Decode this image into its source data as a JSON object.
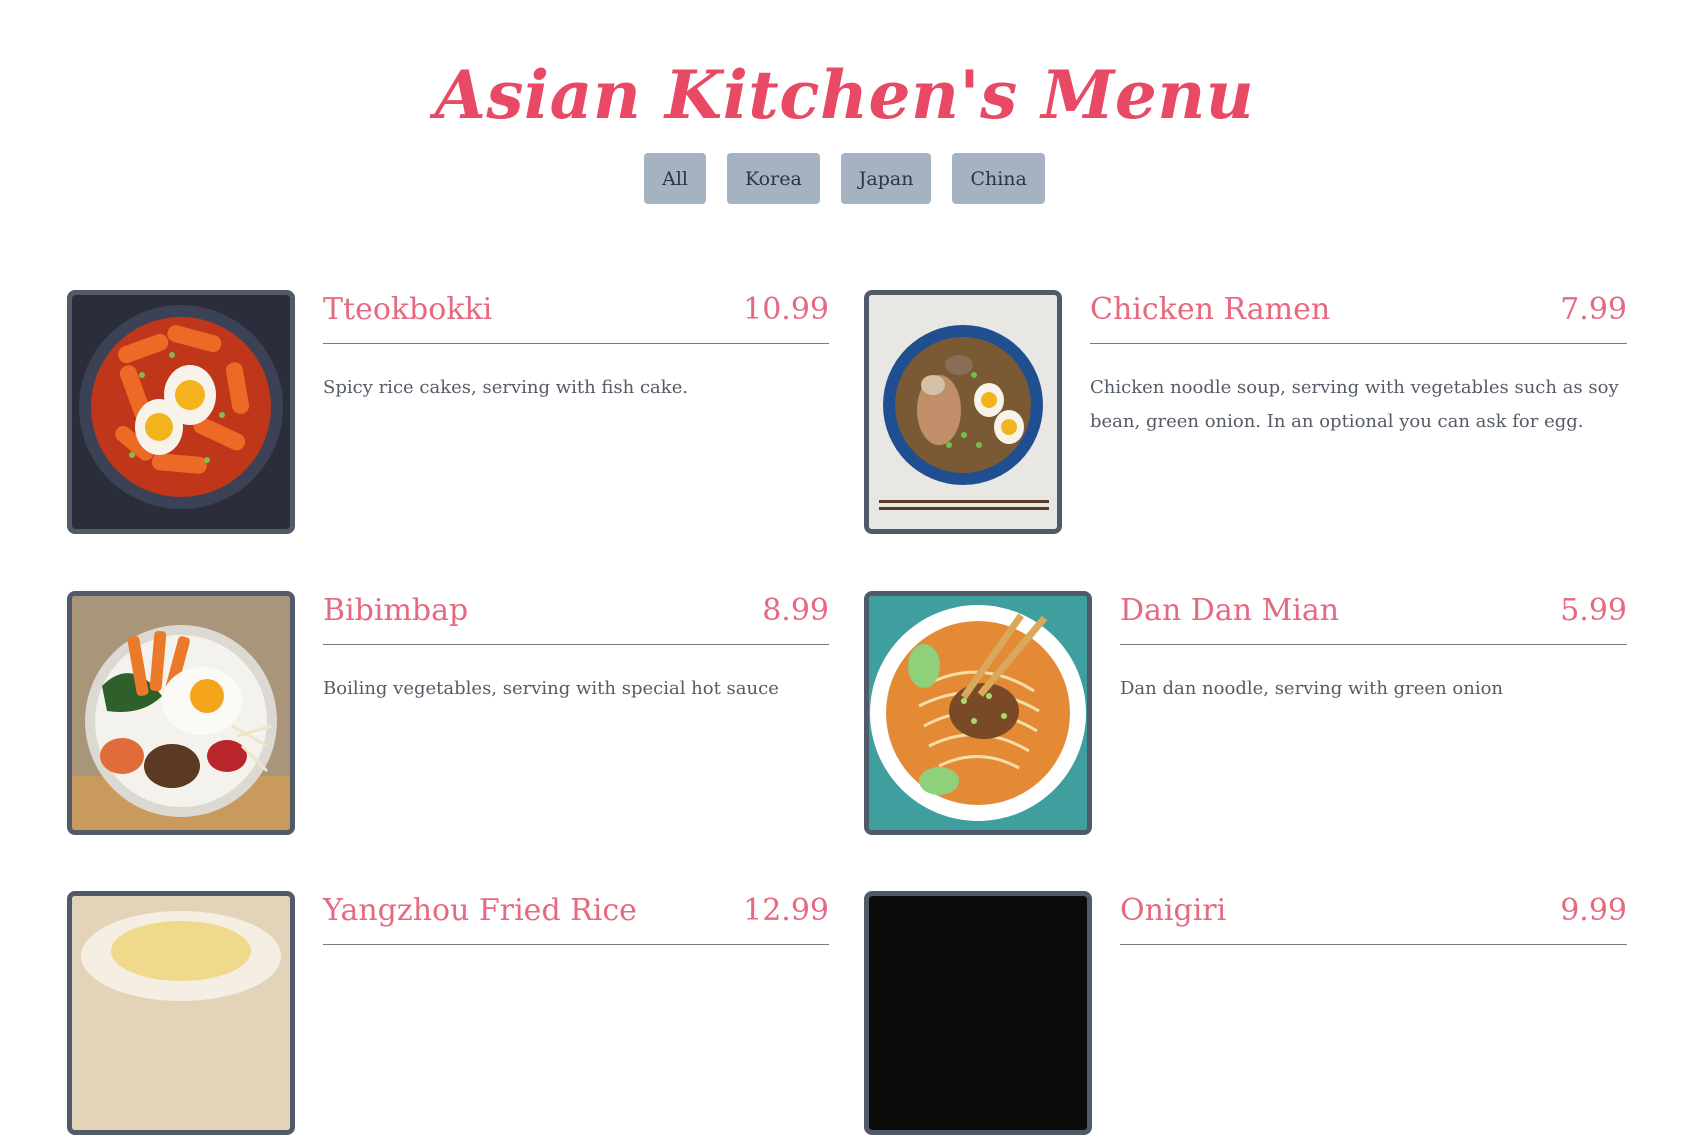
{
  "header": {
    "title": "Asian Kitchen's Menu"
  },
  "filters": [
    "All",
    "Korea",
    "Japan",
    "China"
  ],
  "colors": {
    "title": "#e84a65",
    "dish_name": "#e5697f",
    "filter_button": "#a4b2c2",
    "photo_border": "#505a69"
  },
  "menu": [
    {
      "name": "Tteokbokki",
      "price": "10.99",
      "desc": "Spicy rice cakes, serving with fish cake.",
      "image": "tteokbokki-photo"
    },
    {
      "name": "Chicken Ramen",
      "price": "7.99",
      "desc": "Chicken noodle soup, serving with vegetables such as soy bean, green onion. In an optional you can ask for egg.",
      "image": "chicken-ramen-photo"
    },
    {
      "name": "Bibimbap",
      "price": "8.99",
      "desc": "Boiling vegetables, serving with special hot sauce",
      "image": "bibimbap-photo"
    },
    {
      "name": "Dan Dan Mian",
      "price": "5.99",
      "desc": "Dan dan noodle, serving with green onion",
      "image": "dan-dan-mian-photo"
    },
    {
      "name": "Yangzhou Fried Rice",
      "price": "12.99",
      "desc": "",
      "image": "yangzhou-fried-rice-photo"
    },
    {
      "name": "Onigiri",
      "price": "9.99",
      "desc": "",
      "image": "onigiri-photo"
    }
  ]
}
